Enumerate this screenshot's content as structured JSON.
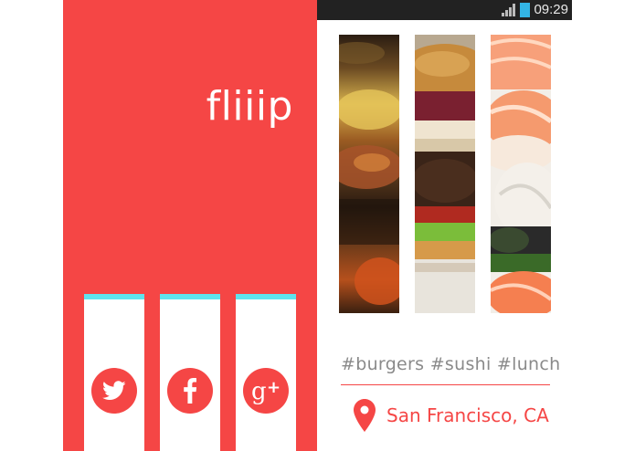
{
  "app": {
    "logo_text": "fliiip"
  },
  "status_bar": {
    "time": "09:29",
    "signal_icon": "signal-bars-icon",
    "battery_icon": "battery-icon"
  },
  "social": [
    {
      "name": "twitter",
      "icon": "twitter-icon"
    },
    {
      "name": "facebook",
      "icon": "facebook-icon"
    },
    {
      "name": "google-plus",
      "icon": "google-plus-icon"
    }
  ],
  "food_images": [
    {
      "subject": "buffet-dishes"
    },
    {
      "subject": "burger"
    },
    {
      "subject": "sushi"
    }
  ],
  "tags": {
    "text": "#burgers #sushi #lunch"
  },
  "location": {
    "text": "San Francisco, CA",
    "icon": "location-pin-icon"
  },
  "colors": {
    "brand_red": "#f54645",
    "accent_cyan": "#5fe3ed",
    "status_bar_bg": "#222222",
    "battery_blue": "#33b5e5",
    "tag_gray": "#8a8a8a"
  }
}
